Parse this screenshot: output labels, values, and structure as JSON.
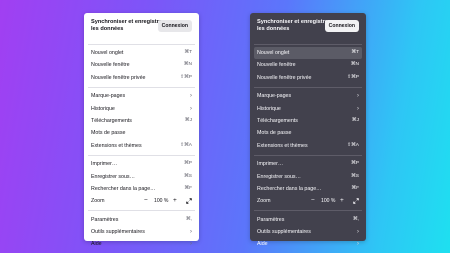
{
  "header": {
    "title": "Synchroniser et enregistrer les données",
    "signin_label": "Connexion"
  },
  "items": {
    "new_tab": {
      "label": "Nouvel onglet",
      "shortcut": "⌘T"
    },
    "new_window": {
      "label": "Nouvelle fenêtre",
      "shortcut": "⌘N"
    },
    "new_private_window": {
      "label": "Nouvelle fenêtre privée",
      "shortcut": "⇧⌘P"
    },
    "bookmarks": {
      "label": "Marque-pages"
    },
    "history": {
      "label": "Historique"
    },
    "downloads": {
      "label": "Téléchargements",
      "shortcut": "⌘J"
    },
    "passwords": {
      "label": "Mots de passe"
    },
    "addons": {
      "label": "Extensions et thèmes",
      "shortcut": "⇧⌘A"
    },
    "print": {
      "label": "Imprimer…",
      "shortcut": "⌘P"
    },
    "save_page": {
      "label": "Enregistrer sous…",
      "shortcut": "⌘S"
    },
    "find": {
      "label": "Rechercher dans la page…",
      "shortcut": "⌘F"
    },
    "zoom": {
      "label": "Zoom",
      "minus": "−",
      "value": "100 %",
      "plus": "+"
    },
    "settings": {
      "label": "Paramètres",
      "shortcut": "⌘,"
    },
    "more_tools": {
      "label": "Outils supplémentaires"
    },
    "help": {
      "label": "Aide"
    }
  },
  "icons": {
    "chevron": "chevron-right-icon",
    "fullscreen": "fullscreen-icon"
  },
  "colors": {
    "light_panel_bg": "#ffffff",
    "dark_panel_bg": "#42414d",
    "dark_active_bg": "#5b5b66"
  }
}
